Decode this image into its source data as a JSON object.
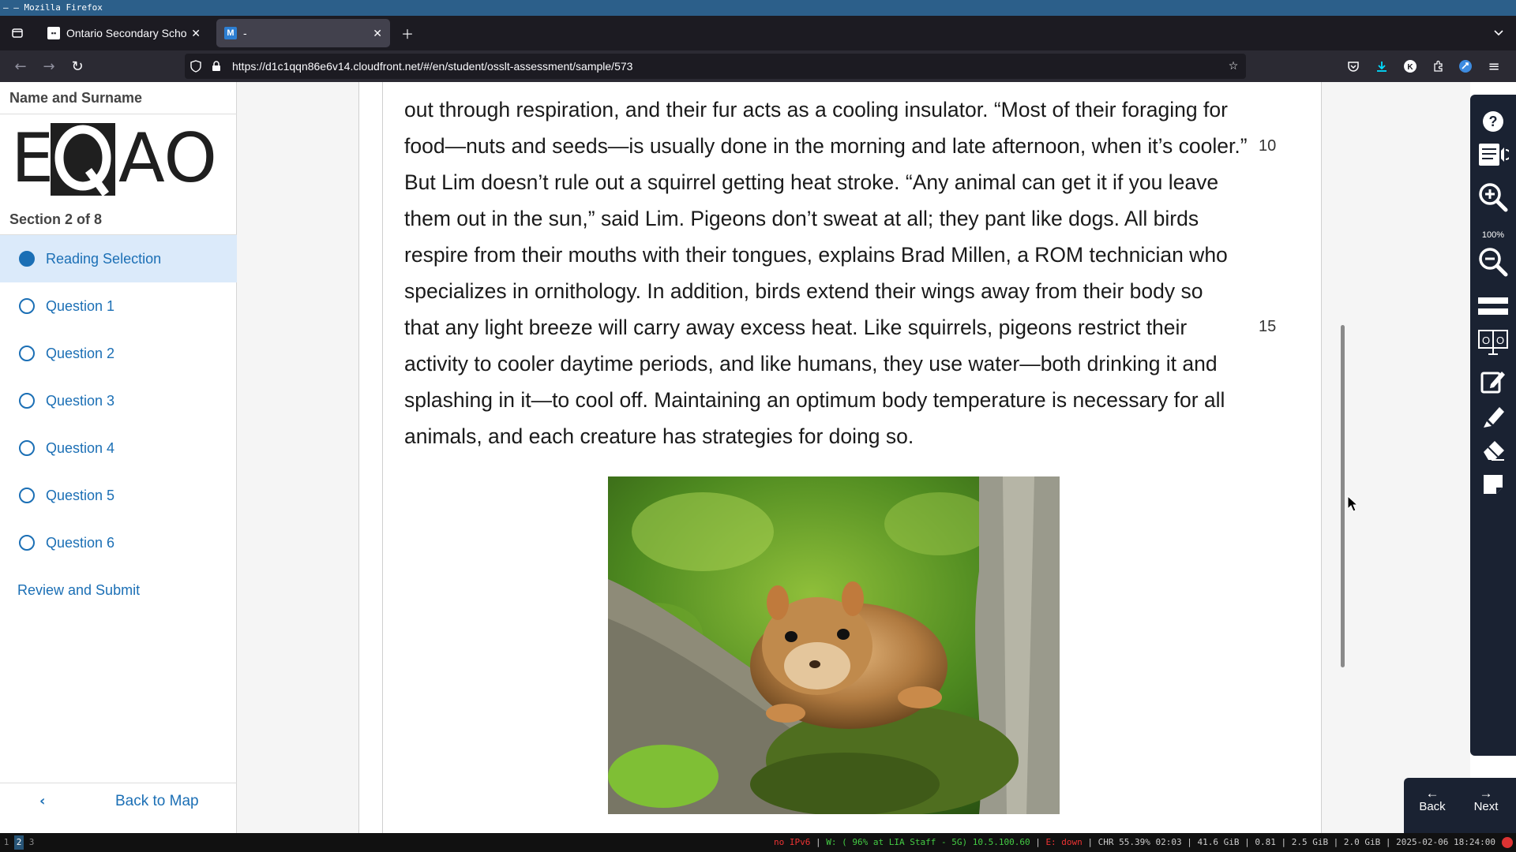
{
  "os": {
    "window_title": "– – Mozilla Firefox"
  },
  "browser": {
    "tabs": [
      {
        "title": "Ontario Secondary School",
        "favicon": "ontario-favicon"
      },
      {
        "title": "-",
        "favicon": "M"
      }
    ],
    "url": "https://d1c1qqn86e6v14.cloudfront.net/#/en/student/osslt-assessment/sample/573"
  },
  "sidebar": {
    "student_name": "Name and Surname",
    "logo_text": "EQAO",
    "section_label": "Section 2 of 8",
    "items": [
      {
        "label": "Reading Selection",
        "selected": true
      },
      {
        "label": "Question 1"
      },
      {
        "label": "Question 2"
      },
      {
        "label": "Question 3"
      },
      {
        "label": "Question 4"
      },
      {
        "label": "Question 5"
      },
      {
        "label": "Question 6"
      }
    ],
    "review_submit": "Review and Submit",
    "back_to_map": "Back to Map"
  },
  "passage": {
    "lines": [
      "out through respiration, and their fur acts as a cooling insulator. “Most of their foraging for",
      "food—nuts and seeds—is usually done in the morning and late afternoon, when it’s cooler.”",
      "But Lim doesn’t rule out a squirrel getting heat stroke. “Any animal can get it if you leave",
      "them out in the sun,” said Lim. Pigeons don’t sweat at all; they pant like dogs. All birds",
      "respire from their mouths with their tongues, explains Brad Millen, a ROM technician who",
      "specializes in ornithology. In addition, birds extend their wings away from their body so",
      "that any light breeze will carry away excess heat. Like squirrels, pigeons restrict their",
      "activity to cooler daytime periods, and like humans, they use water—both drinking it and",
      "splashing in it—to cool off. Maintaining an optimum body temperature is necessary for all",
      "animals, and each creature has strategies for doing so."
    ],
    "line_numbers": [
      "10",
      "15"
    ],
    "image": "squirrel-photo"
  },
  "tools": {
    "zoom_level": "100%",
    "items": [
      "help-icon",
      "text-to-speech-icon",
      "zoom-in-icon",
      "zoom-out-icon",
      "line-reader-icon",
      "toggle-icon",
      "notepad-icon",
      "highlighter-icon",
      "eraser-icon",
      "sticky-note-icon"
    ]
  },
  "footer_nav": {
    "back": "Back",
    "next": "Next"
  },
  "statusbar": {
    "workspaces": [
      "1",
      "2",
      "3"
    ],
    "active_workspace": "2",
    "ipv6": "no IPv6",
    "wifi": "W: ( 96% at LIA Staff - 5G) 10.5.100.60",
    "ethernet": "E: down",
    "system": "CHR 55.39% 02:03 | 41.6 GiB | 0.81 | 2.5 GiB | 2.0 GiB | 2025-02-06 18:24:00"
  }
}
